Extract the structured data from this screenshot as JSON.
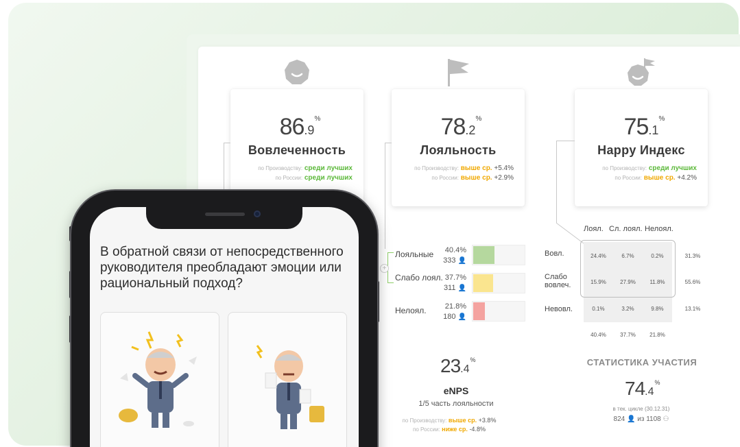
{
  "metrics": [
    {
      "int": "86",
      "dec": "9",
      "unit": "%",
      "title": "Вовлеченность",
      "cmp1_label": "по Производству:",
      "cmp1_value": "среди лучших",
      "cmp1_delta": "",
      "cmp2_label": "по России:",
      "cmp2_value": "среди лучших",
      "cmp2_delta": ""
    },
    {
      "int": "78",
      "dec": "2",
      "unit": "%",
      "title": "Лояльность",
      "cmp1_label": "по Производству:",
      "cmp1_value": "выше ср.",
      "cmp1_delta": "+5.4%",
      "cmp2_label": "по России:",
      "cmp2_value": "выше ср.",
      "cmp2_delta": "+2.9%"
    },
    {
      "int": "75",
      "dec": "1",
      "unit": "%",
      "title": "Happy Индекс",
      "cmp1_label": "по Производству:",
      "cmp1_value": "среди лучших",
      "cmp1_delta": "",
      "cmp2_label": "по России:",
      "cmp2_value": "выше ср.",
      "cmp2_delta": "+4.2%"
    }
  ],
  "loyalty": [
    {
      "label": "Лояльные",
      "pct": "40.4%",
      "count": "333",
      "share": 0.404,
      "color": "#b5d89e"
    },
    {
      "label": "Слабо лоял.",
      "pct": "37.7%",
      "count": "311",
      "share": 0.377,
      "color": "#fae58f"
    },
    {
      "label": "Нелоял.",
      "pct": "21.8%",
      "count": "180",
      "share": 0.218,
      "color": "#f4a3a0"
    }
  ],
  "matrix": {
    "col_headers": [
      "Лоял.",
      "Сл. лоял.",
      "Нелоял."
    ],
    "row_labels": [
      "Вовл.",
      "Слабо вовлеч.",
      "Невовл."
    ],
    "cells": [
      [
        "24.4%",
        "6.7%",
        "0.2%"
      ],
      [
        "15.9%",
        "27.9%",
        "11.8%"
      ],
      [
        "0.1%",
        "3.2%",
        "9.8%"
      ]
    ],
    "row_totals": [
      "31.3%",
      "55.6%",
      "13.1%"
    ],
    "col_totals": [
      "40.4%",
      "37.7%",
      "21.8%"
    ]
  },
  "enps": {
    "int": "23",
    "dec": "4",
    "unit": "%",
    "title": "eNPS",
    "subtitle": "1/5 часть лояльности",
    "cmp1_label": "по Производству:",
    "cmp1_value": "выше ср.",
    "cmp1_delta": "+3.8%",
    "cmp2_label": "по России:",
    "cmp2_value": "ниже ср.",
    "cmp2_delta": "-4.8%"
  },
  "participation": {
    "title": "СТАТИСТИКА УЧАСТИЯ",
    "int": "74",
    "dec": "4",
    "unit": "%",
    "subtitle": "в тек. цикле (30.12.31)",
    "count": "824",
    "of": "из",
    "total": "1108"
  },
  "phone": {
    "question": "В обратной связи от непосредственного руководителя преобладают эмоции или рациональный подход?"
  },
  "colors": {
    "good": "#5cb83a",
    "avg": "#f0a800",
    "accent_green": "#cfe9cc"
  },
  "icons": [
    "smiley-head-icon",
    "flag-icon",
    "head-with-flag-icon",
    "person-icon"
  ]
}
